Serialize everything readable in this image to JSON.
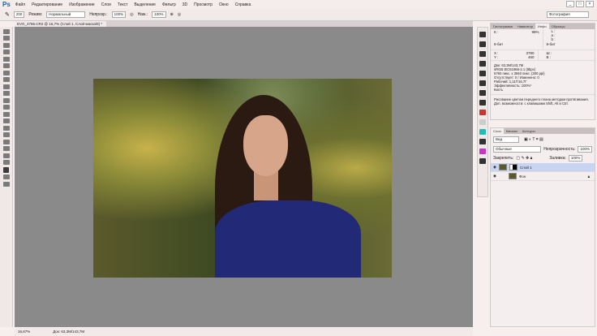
{
  "app": {
    "logo": "Ps"
  },
  "menu": [
    "Файл",
    "Редактирование",
    "Изображение",
    "Слои",
    "Текст",
    "Выделение",
    "Фильтр",
    "3D",
    "Просмотр",
    "Окно",
    "Справка"
  ],
  "window_buttons": [
    "_",
    "□",
    "×"
  ],
  "options": {
    "brush_size": "200",
    "mode_label": "Режим:",
    "mode_value": "Нормальный",
    "opacity_label": "Непрозр.:",
    "opacity_value": "100%",
    "flow_label": "Наж.:",
    "flow_value": "100%"
  },
  "workspace": "Фотография",
  "document_tab": "EVG_4786.CR2 @ 16,7% (Слой 1, Слой-маска/8) *",
  "status": {
    "zoom": "16,67%",
    "doc": "Док: 63,3M/143,7M"
  },
  "info_panel": {
    "tabs": [
      "Гистограмма",
      "Навигатор",
      "Инфо",
      "Образцы"
    ],
    "active_tab": "Инфо",
    "k_label": "K :",
    "k_value": "98%",
    "bit_left": "8-бит",
    "bit_right": "8-бит",
    "lab": [
      "L :",
      "a :",
      "b :"
    ],
    "x_label": "X :",
    "x_value": "3780",
    "y_label": "Y :",
    "y_value": "460",
    "w_label": "Ш :",
    "h_label": "В :",
    "details": [
      "Док: 63,3M/143,7M",
      "sRGB IEC61966-2.1 (8bpc)",
      "5760 пикс. x 3840 пикс. (300 ppi)",
      "Отсутствует: 0 / Изменено: 0",
      "Рабочий: 1,11Г/16,7Г",
      "Эффективность: 100%*",
      "Кисть"
    ],
    "hint": "Рисование цветом переднего плана методом протягивания. Доп. возможности: с клавишами Shift, Alt и Ctrl."
  },
  "layers_panel": {
    "tabs": [
      "Слои",
      "Каналы",
      "Контуры"
    ],
    "filter": "Вид",
    "blend": "Обычные",
    "opacity_label": "Непрозрачность:",
    "opacity_value": "100%",
    "lock_label": "Закрепить:",
    "fill_label": "Заливка:",
    "fill_value": "100%",
    "layers": [
      {
        "name": "Слой 1",
        "selected": true
      },
      {
        "name": "Фон",
        "selected": false
      }
    ]
  }
}
